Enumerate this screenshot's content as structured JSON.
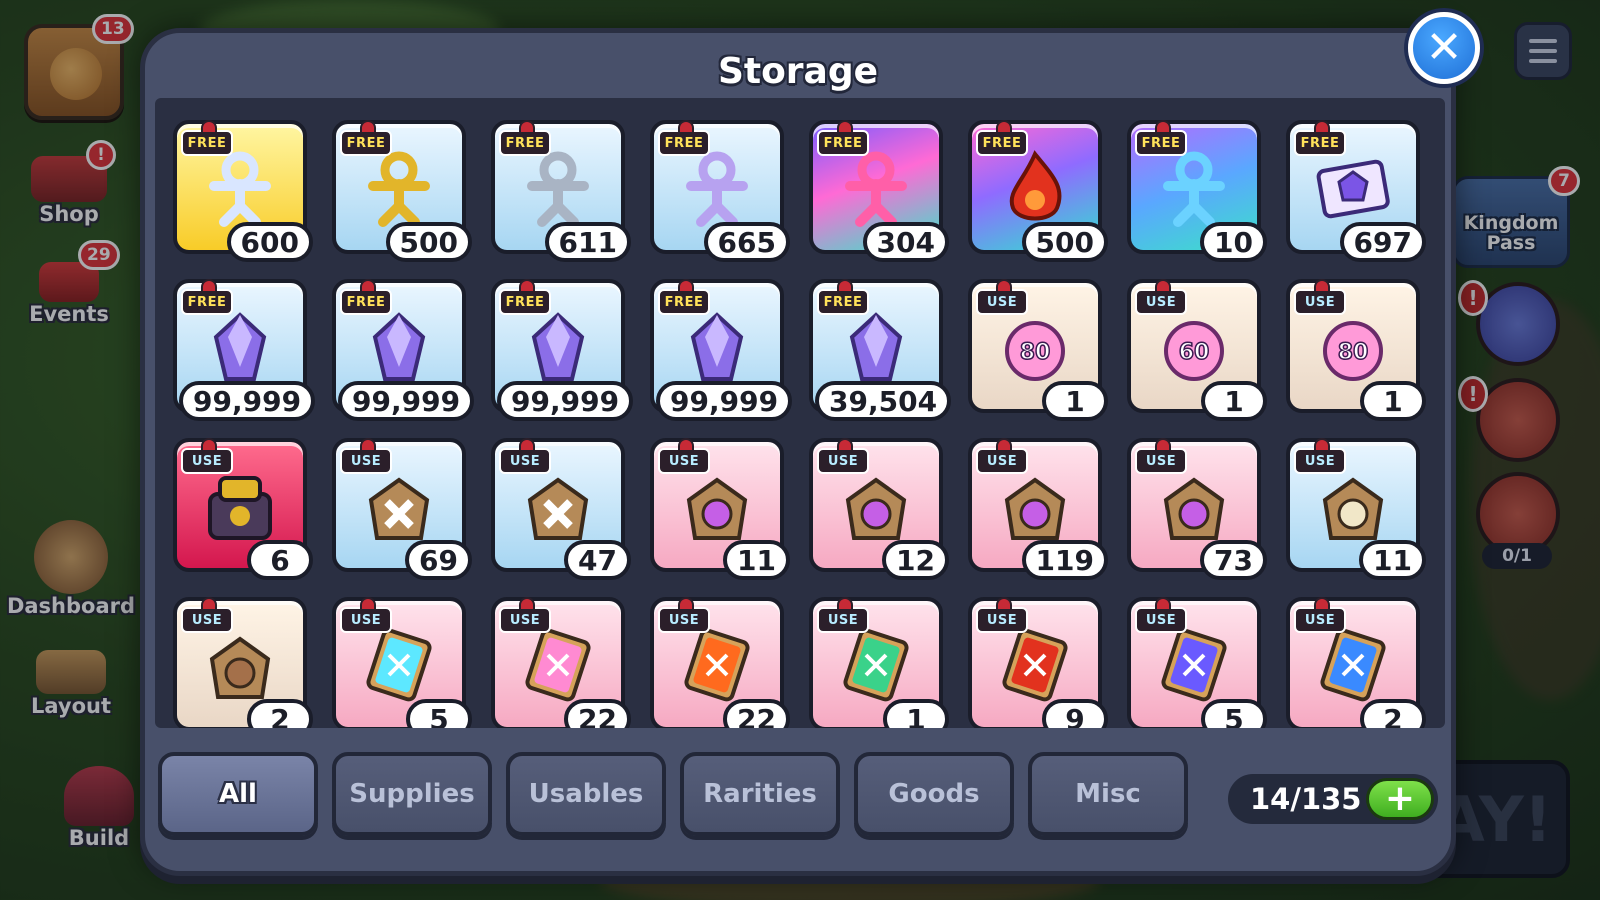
{
  "modal": {
    "title": "Storage",
    "close_icon": "close-icon",
    "capacity": "14/135",
    "tabs": [
      {
        "label": "All",
        "active": true
      },
      {
        "label": "Supplies",
        "active": false
      },
      {
        "label": "Usables",
        "active": false
      },
      {
        "label": "Rarities",
        "active": false
      },
      {
        "label": "Goods",
        "active": false
      },
      {
        "label": "Misc",
        "active": false
      }
    ]
  },
  "items": [
    {
      "tag": "FREE",
      "qty": "600",
      "bg": "yellow",
      "icon": "soulstone-egg-icon"
    },
    {
      "tag": "FREE",
      "qty": "500",
      "bg": "blue",
      "icon": "golden-cookie-icon"
    },
    {
      "tag": "FREE",
      "qty": "611",
      "bg": "blue",
      "icon": "grey-cookie-cutter-icon"
    },
    {
      "tag": "FREE",
      "qty": "665",
      "bg": "blue",
      "icon": "lilac-cookie-cutter-icon"
    },
    {
      "tag": "FREE",
      "qty": "304",
      "bg": "rainbow1",
      "icon": "pink-cookie-cutter-icon"
    },
    {
      "tag": "FREE",
      "qty": "500",
      "bg": "rainbow2",
      "icon": "fire-soulstone-icon"
    },
    {
      "tag": "FREE",
      "qty": "10",
      "bg": "rainbow3",
      "icon": "rainbow-cookie-cutter-icon"
    },
    {
      "tag": "FREE",
      "qty": "697",
      "bg": "blue",
      "icon": "gem-ticket-icon"
    },
    {
      "tag": "FREE",
      "qty": "99,999",
      "bg": "blue",
      "icon": "crystal-shard-icon"
    },
    {
      "tag": "FREE",
      "qty": "99,999",
      "bg": "blue",
      "icon": "crystal-shard-icon"
    },
    {
      "tag": "FREE",
      "qty": "99,999",
      "bg": "blue",
      "icon": "crystal-shard-icon"
    },
    {
      "tag": "FREE",
      "qty": "99,999",
      "bg": "blue",
      "icon": "crystal-shard-icon"
    },
    {
      "tag": "FREE",
      "qty": "39,504",
      "bg": "blue",
      "icon": "crystal-shard-icon"
    },
    {
      "tag": "USE",
      "qty": "1",
      "bg": "cream",
      "icon": "level-80-badge-icon",
      "label": "80"
    },
    {
      "tag": "USE",
      "qty": "1",
      "bg": "cream",
      "icon": "level-60-pouch-icon",
      "label": "60"
    },
    {
      "tag": "USE",
      "qty": "1",
      "bg": "cream",
      "icon": "level-80-pouch-icon",
      "label": "80"
    },
    {
      "tag": "USE",
      "qty": "6",
      "bg": "red",
      "icon": "treasure-chest-icon"
    },
    {
      "tag": "USE",
      "qty": "69",
      "bg": "blue",
      "icon": "bronze-chest-icon"
    },
    {
      "tag": "USE",
      "qty": "47",
      "bg": "blue",
      "icon": "bronze-chest-icon"
    },
    {
      "tag": "USE",
      "qty": "11",
      "bg": "pink",
      "icon": "purple-pouch-chest-icon"
    },
    {
      "tag": "USE",
      "qty": "12",
      "bg": "pink",
      "icon": "purple-pouch-chest-icon"
    },
    {
      "tag": "USE",
      "qty": "119",
      "bg": "pink",
      "icon": "purple-pouch-chest-icon"
    },
    {
      "tag": "USE",
      "qty": "73",
      "bg": "pink",
      "icon": "purple-pouch-chest-icon"
    },
    {
      "tag": "USE",
      "qty": "11",
      "bg": "blue",
      "icon": "cream-pouch-chest-icon"
    },
    {
      "tag": "USE",
      "qty": "2",
      "bg": "cream",
      "icon": "brown-pouch-chest-icon"
    },
    {
      "tag": "USE",
      "qty": "5",
      "bg": "pink",
      "icon": "cyan-topping-card-icon"
    },
    {
      "tag": "USE",
      "qty": "22",
      "bg": "pink",
      "icon": "candy-topping-card-icon"
    },
    {
      "tag": "USE",
      "qty": "22",
      "bg": "pink",
      "icon": "orange-topping-card-icon"
    },
    {
      "tag": "USE",
      "qty": "1",
      "bg": "pink",
      "icon": "green-topping-card-icon"
    },
    {
      "tag": "USE",
      "qty": "9",
      "bg": "pink",
      "icon": "apple-topping-card-icon"
    },
    {
      "tag": "USE",
      "qty": "5",
      "bg": "pink",
      "icon": "purple-topping-card-icon"
    },
    {
      "tag": "USE",
      "qty": "2",
      "bg": "pink",
      "icon": "blue-topping-card-icon"
    }
  ],
  "hud_left": {
    "avatar_badge": "13",
    "shop_label": "Shop",
    "shop_alert": "!",
    "events_label": "Events",
    "events_badge": "29",
    "dashboard_label": "Dashboard",
    "layout_label": "Layout",
    "build_label": "Build"
  },
  "hud_right": {
    "kingdom_pass_label": "Kingdom Pass",
    "kingdom_pass_badge": "7",
    "alert_1": "!",
    "alert_2": "!",
    "counter": "0/1",
    "play_label": "AY!"
  },
  "colors": {
    "modal_bg": "#48506a",
    "grid_bg": "#2a2f42",
    "close_blue": "#1f6fd6",
    "plus_green": "#3fae20",
    "badge_red": "#e2333a"
  }
}
